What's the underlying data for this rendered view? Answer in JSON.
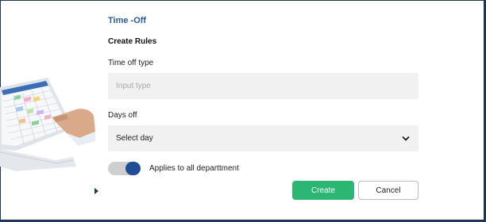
{
  "header": {
    "title": "Time -Off",
    "subtitle": "Create Rules"
  },
  "form": {
    "type_label": "Time off type",
    "type_placeholder": "Input type",
    "days_label": "Days off",
    "days_value": "Select day",
    "toggle_label": "Applies to all departtment",
    "toggle_on": true
  },
  "actions": {
    "create_label": "Create",
    "cancel_label": "Cancel"
  },
  "colors": {
    "title": "#2a5a9b",
    "create": "#2bb673",
    "toggle_knob": "#1f4e97",
    "frame": "#1e3658"
  },
  "icons": {
    "select": "chevron-down-icon"
  }
}
